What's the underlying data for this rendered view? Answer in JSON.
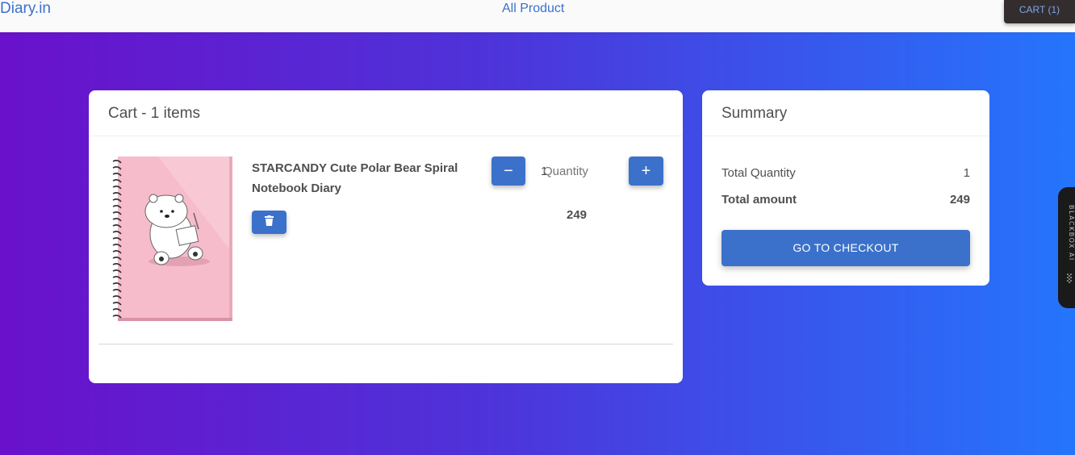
{
  "header": {
    "brand": "Diary.in",
    "nav_link": "All Product",
    "cart_button": "CART (1)"
  },
  "cart": {
    "title": "Cart - 1 items",
    "item": {
      "name": "STARCANDY Cute Polar Bear Spiral Notebook Diary",
      "quantity_value": "1",
      "quantity_label": "Quantity",
      "price": "249",
      "minus_label": "−",
      "plus_label": "+",
      "remove_icon": "trash-icon"
    }
  },
  "summary": {
    "title": "Summary",
    "total_quantity_label": "Total Quantity",
    "total_quantity_value": "1",
    "total_amount_label": "Total amount",
    "total_amount_value": "249",
    "checkout_button": "GO TO CHECKOUT"
  },
  "side_widget": {
    "label": "BLACKBOX AI"
  },
  "colors": {
    "primary": "#3b71ca",
    "gradient_start": "#6a11cb",
    "gradient_end": "#2575fc",
    "notebook_pink": "#f4b8c6"
  }
}
